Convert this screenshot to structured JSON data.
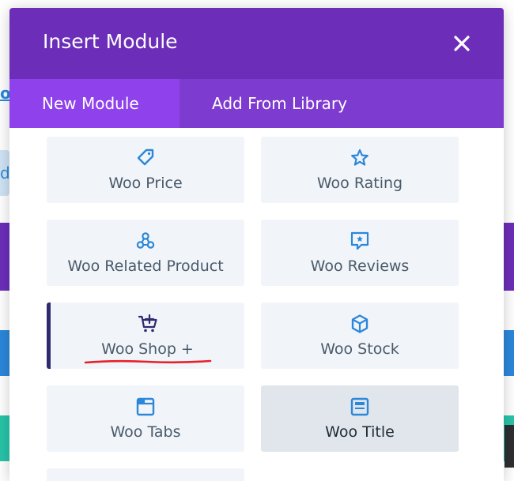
{
  "background": {
    "link_fragment": "o",
    "pill_fragment": "d"
  },
  "modal": {
    "title": "Insert Module",
    "close_glyph": "×",
    "tabs": [
      {
        "label": "New Module",
        "active": true
      },
      {
        "label": "Add From Library",
        "active": false
      }
    ],
    "modules": [
      {
        "label": "Woo Price",
        "icon": "price-tag-icon"
      },
      {
        "label": "Woo Rating",
        "icon": "star-icon"
      },
      {
        "label": "Woo Related Product",
        "icon": "related-nodes-icon"
      },
      {
        "label": "Woo Reviews",
        "icon": "review-bubble-icon"
      },
      {
        "label": "Woo Shop +",
        "icon": "cart-plus-icon",
        "selected": true
      },
      {
        "label": "Woo Stock",
        "icon": "box-icon"
      },
      {
        "label": "Woo Tabs",
        "icon": "tabs-icon"
      },
      {
        "label": "Woo Title",
        "icon": "title-icon",
        "hovered": true
      }
    ]
  },
  "colors": {
    "header": "#6c2eb9",
    "tabs_bar": "#7e3bd0",
    "active_tab": "#8f42ec",
    "module_bg": "#f1f5f9",
    "module_hover_bg": "#e1e6ec",
    "icon_blue": "#2b87da",
    "icon_selected": "#2e2a6e",
    "annotation_red": "#e8202a"
  }
}
